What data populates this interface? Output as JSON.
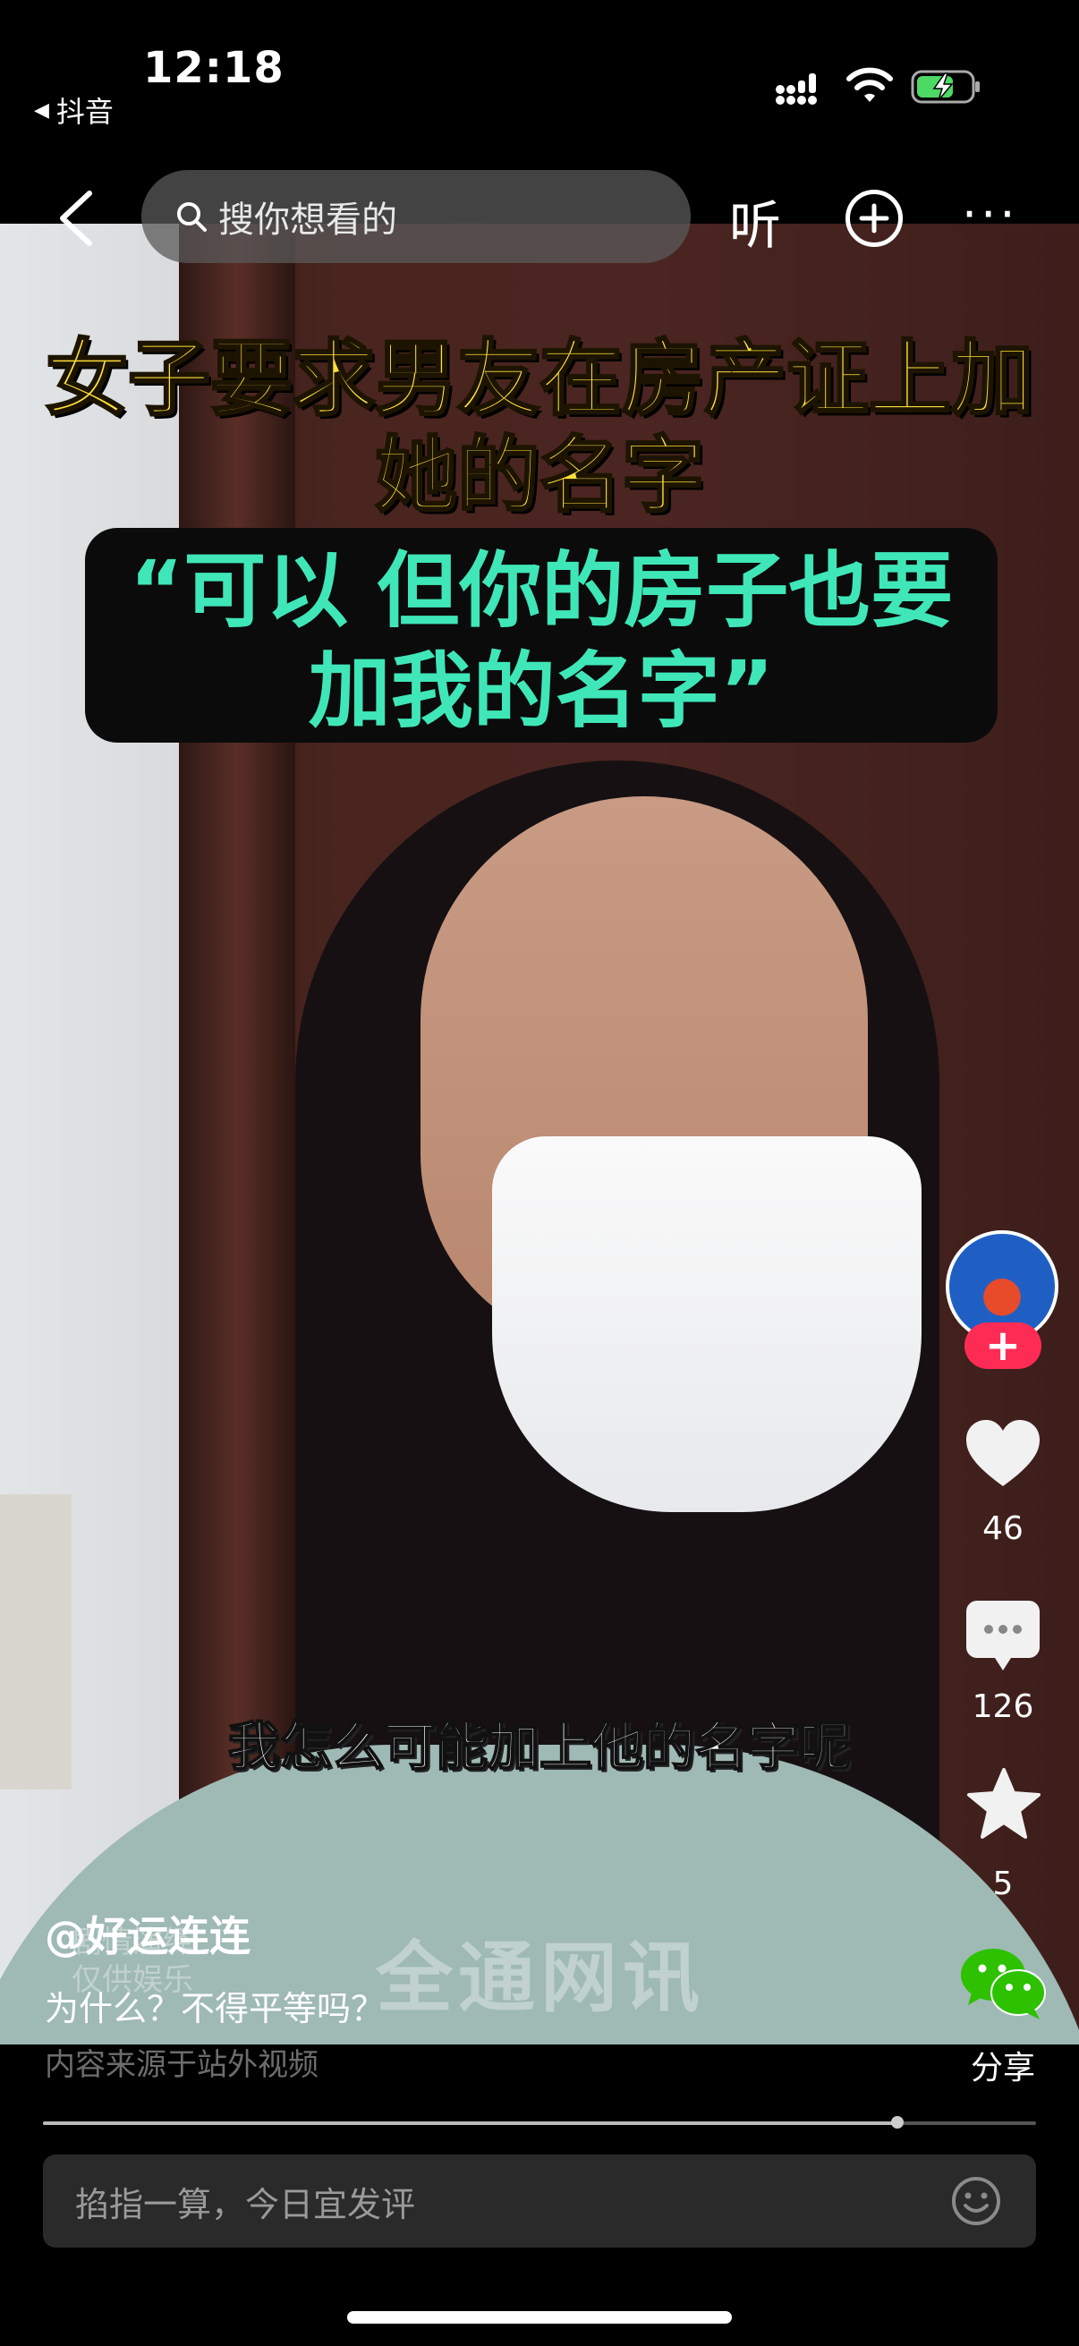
{
  "status_bar": {
    "time": "12:18",
    "back_app": "抖音"
  },
  "top_nav": {
    "search_placeholder": "搜你想看的",
    "listen_label": "听"
  },
  "video": {
    "title_line1": "女子要求男友在房产证上加",
    "title_line2": "她的名字",
    "quote_line1": "“可以 但你的房子也要",
    "quote_line2": "加我的名字”",
    "subtitle": "我怎么可能加上他的名字呢",
    "watermark": "全通网讯",
    "disclaimer": "剧情演绎 仅供娱乐"
  },
  "rail": {
    "likes": "46",
    "comments": "126",
    "favorites": "5",
    "share_label": "分享"
  },
  "caption": {
    "author": "@好运连连",
    "description": "为什么？不得平等吗？",
    "source_note": "内容来源于站外视频"
  },
  "playback": {
    "progress": 0.86
  },
  "comment_bar": {
    "placeholder": "掐指一算，今日宜发评"
  },
  "colors": {
    "quote_green": "#3fe7b8",
    "title_yellow": "#ffe03a",
    "follow_red": "#fe2c55"
  }
}
